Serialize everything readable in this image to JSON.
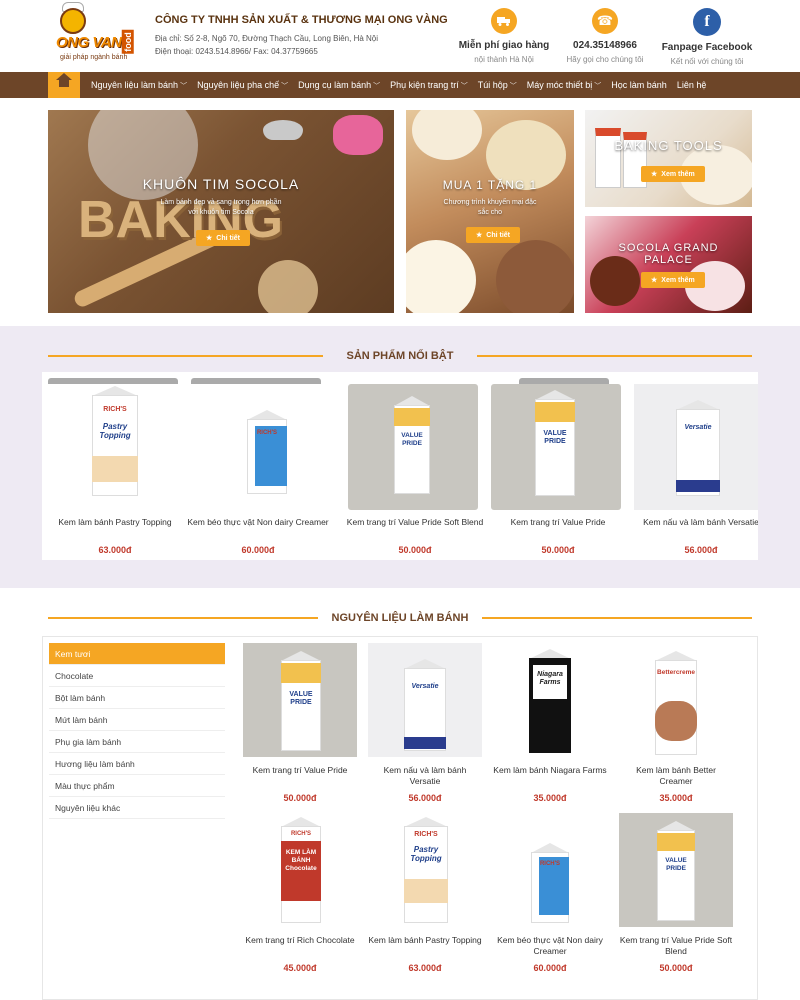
{
  "header": {
    "logo_text": "ONG VANG",
    "logo_sub": "food",
    "logo_slogan": "giải pháp ngành bánh",
    "company_name": "CÔNG TY TNHH SẢN XUẤT & THƯƠNG MẠI ONG VÀNG",
    "address": "Địa chỉ: Số 2-8, Ngõ 70, Đường Thạch Cầu, Long Biên, Hà Nội",
    "phone": "Điện thoại: 0243.514.8966/ Fax: 04.37759665",
    "boxes": [
      {
        "icon": "truck-icon",
        "title": "Miễn phí giao hàng",
        "sub": "nội thành Hà Nội"
      },
      {
        "icon": "phone-icon",
        "title": "024.35148966",
        "sub": "Hãy gọi cho chúng tôi"
      },
      {
        "icon": "facebook-icon",
        "title": "Fanpage Facebook",
        "sub": "Kết nối với chúng tôi"
      }
    ]
  },
  "nav": [
    {
      "label": "Nguyên liệu làm bánh",
      "chev": "﹀"
    },
    {
      "label": "Nguyên liệu pha chế",
      "chev": "﹀"
    },
    {
      "label": "Dụng cụ làm bánh",
      "chev": "﹀"
    },
    {
      "label": "Phụ kiện trang trí",
      "chev": "﹀"
    },
    {
      "label": "Túi hộp",
      "chev": "﹀"
    },
    {
      "label": "Máy móc thiết bị",
      "chev": "﹀"
    },
    {
      "label": "Học làm bánh",
      "chev": ""
    },
    {
      "label": "Liên hệ",
      "chev": ""
    }
  ],
  "banners": {
    "b1": {
      "title": "KHUÔN TIM SOCOLA",
      "desc1": "Làm bánh đẹp và sang trọng hơn phần",
      "desc2": "với khuôn tim Socola",
      "button": "Chi tiết",
      "letters": "BAKING"
    },
    "b2": {
      "title": "MUA 1 TẶNG 1",
      "desc1": "Chương trình khuyến mại đặc",
      "desc2": "sắc cho",
      "button": "Chi tiết"
    },
    "b3": {
      "title": "BAKING TOOLS",
      "button": "Xem thêm"
    },
    "b4": {
      "title": "SOCOLA GRAND PALACE",
      "button": "Xem thêm"
    }
  },
  "featured": {
    "title": "SẢN PHẨM NỔI BẬT",
    "items": [
      {
        "name": "Kem làm bánh Pastry Topping",
        "price": "63.000đ"
      },
      {
        "name": "Kem béo thực vật Non dairy Creamer",
        "price": "60.000đ"
      },
      {
        "name": "Kem trang trí Value Pride Soft Blend",
        "price": "50.000đ"
      },
      {
        "name": "Kem trang trí Value Pride",
        "price": "50.000đ"
      },
      {
        "name": "Kem nấu và làm bánh Versatie",
        "price": "56.000đ"
      }
    ]
  },
  "category": {
    "title": "NGUYÊN LIỆU LÀM BÁNH",
    "items": [
      "Kem tươi",
      "Chocolate",
      "Bột làm bánh",
      "Mứt làm bánh",
      "Phụ gia làm bánh",
      "Hương liệu làm bánh",
      "Màu thực phẩm",
      "Nguyên liệu khác"
    ],
    "products": [
      {
        "name": "Kem trang trí Value Pride",
        "price": "50.000đ"
      },
      {
        "name": "Kem nấu và làm bánh Versatie",
        "price": "56.000đ"
      },
      {
        "name": "Kem làm bánh Niagara Farms",
        "price": "35.000đ"
      },
      {
        "name": "Kem làm bánh Better Creamer",
        "price": "35.000đ"
      },
      {
        "name": "Kem trang trí Rich Chocolate",
        "price": "45.000đ"
      },
      {
        "name": "Kem làm bánh Pastry Topping",
        "price": "63.000đ"
      },
      {
        "name": "Kem béo thực vật Non dairy Creamer",
        "price": "60.000đ"
      },
      {
        "name": "Kem trang trí Value Pride Soft Blend",
        "price": "50.000đ"
      }
    ]
  },
  "box_labels": {
    "rich": "RICH'S",
    "pastry": "Pastry Topping",
    "value": "VALUE PRIDE",
    "versatie": "Versatie",
    "niagara": "Niagara Farms",
    "better": "Bettercreme",
    "chocolate": "KEM LÀM BÁNH Chocolate"
  },
  "colors": {
    "brown": "#6d4528",
    "orange": "#f5a623",
    "price": "#c0392b"
  }
}
